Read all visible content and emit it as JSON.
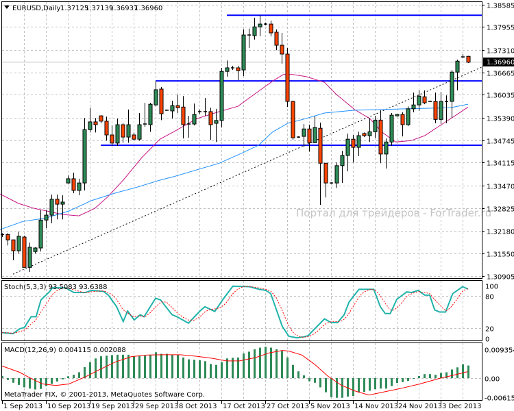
{
  "header": {
    "symbol": "EURUSD,Daily",
    "open": "1.37125",
    "high": "1.37139",
    "low": "1.36937",
    "close": "1.36960"
  },
  "price_axis": [
    "1.38585",
    "1.37955",
    "1.37310",
    "1.36665",
    "1.36035",
    "1.35390",
    "1.34745",
    "1.34115",
    "1.33470",
    "1.32825",
    "1.32180",
    "1.31550",
    "1.30905"
  ],
  "current_price_label": "1.36960",
  "watermark": "Портал для трейдеров - ForTrader.ru",
  "copyright": "MetaTrader FIX, © 2001-2013, MetaQuotes Software Corp.",
  "stoch": {
    "title": "Stoch(5,3,3) 93.5083 93.6388",
    "axis": [
      "100",
      "80",
      "20",
      "0"
    ]
  },
  "macd": {
    "title": "MACD(12,26,9) 0.004115 0.002088",
    "axis": [
      "0.009354",
      "0.00",
      "-0.006153"
    ]
  },
  "date_axis": [
    "1 Sep 2013",
    "10 Sep 2013",
    "19 Sep 2013",
    "29 Sep 2013",
    "8 Oct 2013",
    "17 Oct 2013",
    "27 Oct 2013",
    "5 Nov 2013",
    "14 Nov 2013",
    "24 Nov 2013",
    "3 Dec 2013"
  ],
  "colors": {
    "bull": "#2e8b57",
    "bear": "#ff4500",
    "level": "#0000ff",
    "ma_fast": "#c71585",
    "ma_slow": "#1e90ff",
    "stoch_main": "#20b2aa",
    "signal": "#ff0000",
    "hist": "#2e8b57"
  },
  "chart_data": {
    "type": "candlestick",
    "date_label_every_bars": 8,
    "ylim": [
      1.30905,
      1.38585
    ],
    "candles_ohlc": [
      [
        1.3208,
        1.3212,
        1.3201,
        1.3208
      ],
      [
        1.3208,
        1.3212,
        1.3177,
        1.3193
      ],
      [
        1.3193,
        1.3193,
        1.3135,
        1.3162
      ],
      [
        1.3162,
        1.3216,
        1.3154,
        1.3203
      ],
      [
        1.3201,
        1.3205,
        1.3115,
        1.3115
      ],
      [
        1.3115,
        1.3185,
        1.3102,
        1.3172
      ],
      [
        1.316,
        1.3172,
        1.3154,
        1.317
      ],
      [
        1.317,
        1.3277,
        1.316,
        1.3249
      ],
      [
        1.3249,
        1.3277,
        1.3226,
        1.3263
      ],
      [
        1.3263,
        1.3321,
        1.324,
        1.3308
      ],
      [
        1.3308,
        1.3321,
        1.3251,
        1.3294
      ],
      [
        1.3294,
        1.3319,
        1.3251,
        1.33
      ],
      [
        1.3354,
        1.3375,
        1.3352,
        1.3366
      ],
      [
        1.3366,
        1.3383,
        1.3325,
        1.3333
      ],
      [
        1.3333,
        1.3366,
        1.3319,
        1.3354
      ],
      [
        1.3354,
        1.3538,
        1.3333,
        1.3505
      ],
      [
        1.3505,
        1.3567,
        1.3497,
        1.3527
      ],
      [
        1.3527,
        1.3538,
        1.3497,
        1.3519
      ],
      [
        1.3544,
        1.3546,
        1.3523,
        1.3529
      ],
      [
        1.3529,
        1.3542,
        1.3474,
        1.349
      ],
      [
        1.349,
        1.3517,
        1.3459,
        1.3467
      ],
      [
        1.3467,
        1.3536,
        1.3459,
        1.3519
      ],
      [
        1.3519,
        1.3523,
        1.3468,
        1.3484
      ],
      [
        1.3484,
        1.3562,
        1.3468,
        1.3519
      ],
      [
        1.349,
        1.3497,
        1.3474,
        1.3478
      ],
      [
        1.3478,
        1.3552,
        1.3474,
        1.3519
      ],
      [
        1.3521,
        1.3581,
        1.3513,
        1.3521
      ],
      [
        1.3519,
        1.3581,
        1.3499,
        1.3577
      ],
      [
        1.3575,
        1.3643,
        1.3571,
        1.3618
      ],
      [
        1.362,
        1.3626,
        1.3532,
        1.355
      ],
      [
        1.356,
        1.3562,
        1.3558,
        1.356
      ],
      [
        1.3558,
        1.3587,
        1.3536,
        1.3573
      ],
      [
        1.3573,
        1.3604,
        1.3552,
        1.3567
      ],
      [
        1.3569,
        1.36,
        1.348,
        1.3519
      ],
      [
        1.3521,
        1.3544,
        1.3482,
        1.3521
      ],
      [
        1.3521,
        1.3579,
        1.3517,
        1.3548
      ],
      [
        1.3556,
        1.3562,
        1.355,
        1.3556
      ],
      [
        1.3556,
        1.3595,
        1.3544,
        1.3556
      ],
      [
        1.3556,
        1.3567,
        1.3476,
        1.3519
      ],
      [
        1.3523,
        1.3564,
        1.347,
        1.3531
      ],
      [
        1.3531,
        1.368,
        1.3511,
        1.367
      ],
      [
        1.367,
        1.3701,
        1.3655,
        1.368
      ],
      [
        1.368,
        1.3686,
        1.3674,
        1.368
      ],
      [
        1.368,
        1.3686,
        1.3645,
        1.3672
      ],
      [
        1.3674,
        1.3789,
        1.3657,
        1.3773
      ],
      [
        1.3773,
        1.3791,
        1.3736,
        1.3771
      ],
      [
        1.3771,
        1.3822,
        1.376,
        1.3796
      ],
      [
        1.3796,
        1.3829,
        1.3769,
        1.3804
      ],
      [
        1.3804,
        1.3808,
        1.38,
        1.3804
      ],
      [
        1.3804,
        1.3814,
        1.3769,
        1.3779
      ],
      [
        1.3781,
        1.3789,
        1.373,
        1.3744
      ],
      [
        1.3744,
        1.3779,
        1.3692,
        1.3719
      ],
      [
        1.3719,
        1.3736,
        1.3569,
        1.3585
      ],
      [
        1.3585,
        1.3587,
        1.3476,
        1.3482
      ],
      [
        1.3484,
        1.3486,
        1.3482,
        1.3484
      ],
      [
        1.3486,
        1.3521,
        1.3455,
        1.3507
      ],
      [
        1.3507,
        1.3519,
        1.3443,
        1.3468
      ],
      [
        1.3468,
        1.3544,
        1.3467,
        1.3511
      ],
      [
        1.3509,
        1.3525,
        1.3292,
        1.341
      ],
      [
        1.341,
        1.341,
        1.3313,
        1.3354
      ],
      [
        1.3354,
        1.3356,
        1.3352,
        1.3354
      ],
      [
        1.3354,
        1.3412,
        1.334,
        1.3403
      ],
      [
        1.3403,
        1.3445,
        1.3354,
        1.3432
      ],
      [
        1.3432,
        1.3494,
        1.3387,
        1.3478
      ],
      [
        1.3478,
        1.349,
        1.3412,
        1.3455
      ],
      [
        1.3455,
        1.3499,
        1.343,
        1.3488
      ],
      [
        1.3494,
        1.3497,
        1.3484,
        1.3488
      ],
      [
        1.3488,
        1.3538,
        1.347,
        1.3499
      ],
      [
        1.3499,
        1.3544,
        1.3482,
        1.3532
      ],
      [
        1.3532,
        1.356,
        1.341,
        1.3436
      ],
      [
        1.3436,
        1.348,
        1.3395,
        1.347
      ],
      [
        1.347,
        1.3552,
        1.3459,
        1.3546
      ],
      [
        1.3544,
        1.3548,
        1.3542,
        1.3548
      ],
      [
        1.3548,
        1.3554,
        1.3486,
        1.3519
      ],
      [
        1.3519,
        1.3571,
        1.3515,
        1.3564
      ],
      [
        1.3564,
        1.361,
        1.3554,
        1.3575
      ],
      [
        1.3575,
        1.3616,
        1.3558,
        1.36
      ],
      [
        1.3598,
        1.3616,
        1.3577,
        1.3581
      ],
      [
        1.3585,
        1.3587,
        1.3583,
        1.3585
      ],
      [
        1.3585,
        1.361,
        1.3523,
        1.3534
      ],
      [
        1.3534,
        1.3612,
        1.3521,
        1.3585
      ],
      [
        1.3585,
        1.3602,
        1.3523,
        1.3585
      ],
      [
        1.3585,
        1.3674,
        1.3538,
        1.3668
      ],
      [
        1.3668,
        1.3703,
        1.3616,
        1.3699
      ],
      [
        1.3711,
        1.3719,
        1.3707,
        1.3711
      ],
      [
        1.37125,
        1.37139,
        1.36937,
        1.3696
      ]
    ],
    "levels": [
      {
        "price": 1.3829,
        "from_bar": 41
      },
      {
        "price": 1.3643,
        "from_bar": 28
      },
      {
        "price": 1.3461,
        "from_bar": 18
      }
    ],
    "trendline": [
      [
        2,
        1.3096
      ],
      [
        87.5,
        1.3682
      ]
    ],
    "ma_fast": [
      [
        -0.4,
        1.3323
      ],
      [
        3,
        1.3296
      ],
      [
        5.9,
        1.3282
      ],
      [
        8.4,
        1.3274
      ],
      [
        10.9,
        1.3265
      ],
      [
        14,
        1.3261
      ],
      [
        16.9,
        1.3282
      ],
      [
        19.3,
        1.3315
      ],
      [
        22.1,
        1.3362
      ],
      [
        25.5,
        1.3426
      ],
      [
        28.8,
        1.3478
      ],
      [
        31.3,
        1.3499
      ],
      [
        35.5,
        1.3536
      ],
      [
        39.6,
        1.3556
      ],
      [
        43,
        1.3571
      ],
      [
        46.8,
        1.3614
      ],
      [
        49.6,
        1.3645
      ],
      [
        51.3,
        1.3661
      ],
      [
        53,
        1.3661
      ],
      [
        55.5,
        1.3655
      ],
      [
        58.8,
        1.3639
      ],
      [
        60.9,
        1.3606
      ],
      [
        64.3,
        1.3562
      ],
      [
        67.1,
        1.3536
      ],
      [
        69.3,
        1.3498
      ],
      [
        71.8,
        1.347
      ],
      [
        74.6,
        1.3474
      ],
      [
        77.1,
        1.3488
      ],
      [
        80.5,
        1.3523
      ],
      [
        83,
        1.3548
      ],
      [
        85,
        1.3569
      ]
    ],
    "ma_slow": [
      [
        -0.4,
        1.3222
      ],
      [
        3.8,
        1.3245
      ],
      [
        8,
        1.3255
      ],
      [
        12.1,
        1.3274
      ],
      [
        16.3,
        1.3304
      ],
      [
        20.5,
        1.3325
      ],
      [
        24.6,
        1.3342
      ],
      [
        28.8,
        1.3362
      ],
      [
        31.3,
        1.3372
      ],
      [
        39.6,
        1.341
      ],
      [
        43.8,
        1.3439
      ],
      [
        46.8,
        1.3461
      ],
      [
        49.3,
        1.3498
      ],
      [
        52.1,
        1.3523
      ],
      [
        55.3,
        1.3536
      ],
      [
        58.8,
        1.3552
      ],
      [
        64.3,
        1.356
      ],
      [
        69.3,
        1.3562
      ],
      [
        73.4,
        1.3564
      ],
      [
        81.8,
        1.3567
      ],
      [
        85,
        1.3577
      ]
    ],
    "stoch_main": [
      [
        -0.1,
        11
      ],
      [
        2,
        9
      ],
      [
        3.2,
        18
      ],
      [
        4.1,
        21
      ],
      [
        5.3,
        41
      ],
      [
        6.2,
        41
      ],
      [
        7.1,
        73
      ],
      [
        8.6,
        88
      ],
      [
        9.2,
        96
      ],
      [
        11.6,
        96
      ],
      [
        13.1,
        87
      ],
      [
        15.2,
        87
      ],
      [
        16.4,
        91
      ],
      [
        18.5,
        89
      ],
      [
        19.4,
        82
      ],
      [
        20.9,
        60
      ],
      [
        22.1,
        32
      ],
      [
        22.9,
        52
      ],
      [
        24.1,
        35
      ],
      [
        25.2,
        45
      ],
      [
        25.9,
        41
      ],
      [
        28,
        76
      ],
      [
        28.9,
        73
      ],
      [
        31,
        45
      ],
      [
        31.9,
        41
      ],
      [
        34,
        29
      ],
      [
        36.1,
        52
      ],
      [
        37,
        60
      ],
      [
        38.8,
        51
      ],
      [
        40.3,
        74
      ],
      [
        42.1,
        99
      ],
      [
        45.1,
        98
      ],
      [
        46.9,
        93
      ],
      [
        48.1,
        91
      ],
      [
        49,
        85
      ],
      [
        51.1,
        23
      ],
      [
        52.3,
        4
      ],
      [
        53.8,
        1
      ],
      [
        55,
        3
      ],
      [
        55.8,
        5
      ],
      [
        58.8,
        37
      ],
      [
        60,
        30
      ],
      [
        61.2,
        30
      ],
      [
        62.4,
        45
      ],
      [
        63.3,
        69
      ],
      [
        65.1,
        93
      ],
      [
        67.8,
        93
      ],
      [
        69,
        60
      ],
      [
        69.9,
        47
      ],
      [
        70.8,
        47
      ],
      [
        72,
        74
      ],
      [
        73.8,
        88
      ],
      [
        74.7,
        87
      ],
      [
        75.9,
        91
      ],
      [
        77.1,
        82
      ],
      [
        78,
        82
      ],
      [
        78.9,
        54
      ],
      [
        79.8,
        50
      ],
      [
        80.9,
        50
      ],
      [
        82.2,
        85
      ],
      [
        84,
        98
      ],
      [
        85,
        93.5
      ]
    ],
    "macd_hist": [
      0.0007,
      -0.0006,
      -0.0015,
      -0.0022,
      -0.003,
      -0.0034,
      -0.0037,
      -0.0035,
      -0.0026,
      -0.0019,
      -0.0011,
      -0.0004,
      0.0006,
      0.0011,
      0.0019,
      0.0036,
      0.0052,
      0.0064,
      0.0071,
      0.0073,
      0.0075,
      0.0076,
      0.0076,
      0.0076,
      0.0071,
      0.0073,
      0.0073,
      0.0075,
      0.0084,
      0.0079,
      0.0079,
      0.0076,
      0.0076,
      0.0067,
      0.0061,
      0.006,
      0.0058,
      0.0055,
      0.0046,
      0.0043,
      0.0052,
      0.0064,
      0.0066,
      0.0067,
      0.008,
      0.0086,
      0.0094,
      0.0099,
      0.0102,
      0.0099,
      0.0094,
      0.0088,
      0.0067,
      0.0043,
      0.0022,
      0.0009,
      -0.001,
      -0.0015,
      -0.003,
      -0.0046,
      -0.0062,
      -0.0064,
      -0.0064,
      -0.006,
      -0.0058,
      -0.0047,
      -0.0045,
      -0.0041,
      -0.0036,
      -0.0034,
      -0.0034,
      -0.0026,
      -0.0016,
      -0.0013,
      -0.0009,
      -0.0001,
      0.0007,
      0.0013,
      0.0013,
      0.0011,
      0.0017,
      0.0019,
      0.0028,
      0.0035,
      0.0045,
      0.0041
    ],
    "macd_signal": [
      [
        -0.1,
        0.004
      ],
      [
        3.2,
        0.0019
      ],
      [
        5.6,
        -0.0004
      ],
      [
        7.4,
        -0.0019
      ],
      [
        9.8,
        -0.0024
      ],
      [
        12.2,
        -0.0019
      ],
      [
        15.2,
        0.0004
      ],
      [
        17.6,
        0.0026
      ],
      [
        20.6,
        0.0052
      ],
      [
        23.6,
        0.007
      ],
      [
        26.5,
        0.0075
      ],
      [
        29.5,
        0.0076
      ],
      [
        32.5,
        0.0076
      ],
      [
        35.5,
        0.0071
      ],
      [
        38.5,
        0.0064
      ],
      [
        40.9,
        0.0056
      ],
      [
        43.3,
        0.0056
      ],
      [
        46.3,
        0.0067
      ],
      [
        48.7,
        0.0082
      ],
      [
        51.1,
        0.009
      ],
      [
        52.3,
        0.0088
      ],
      [
        54.7,
        0.0075
      ],
      [
        57,
        0.0045
      ],
      [
        59.4,
        0.0007
      ],
      [
        61.8,
        -0.0022
      ],
      [
        64.2,
        -0.0041
      ],
      [
        66.9,
        -0.0055
      ],
      [
        69.6,
        -0.0045
      ],
      [
        72.6,
        -0.0034
      ],
      [
        76.2,
        -0.0019
      ],
      [
        79.8,
        -0.0001
      ],
      [
        82.2,
        0.0009
      ],
      [
        84.9,
        0.0021
      ]
    ]
  }
}
